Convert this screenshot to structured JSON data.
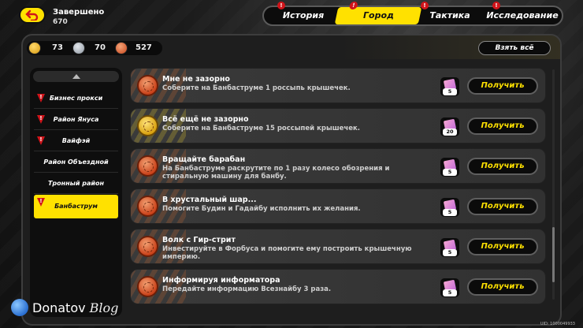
{
  "status": {
    "title": "Завершено",
    "count": "670"
  },
  "tabs": [
    {
      "label": "История",
      "alert": true,
      "active": false
    },
    {
      "label": "Город",
      "alert": true,
      "active": true
    },
    {
      "label": "Тактика",
      "alert": true,
      "active": false
    },
    {
      "label": "Исследование",
      "alert": true,
      "active": false
    }
  ],
  "currency": [
    {
      "icon": "gold-coin-icon",
      "value": "73",
      "color": "#e8b020"
    },
    {
      "icon": "silver-coin-icon",
      "value": "70",
      "color": "#9aa3ad"
    },
    {
      "icon": "bronze-coin-icon",
      "value": "527",
      "color": "#d35b2a"
    }
  ],
  "take_all_label": "Взять всё",
  "sidebar": {
    "items": [
      {
        "label": "Бизнес прокси",
        "alert": true,
        "active": false
      },
      {
        "label": "Район Януса",
        "alert": true,
        "active": false
      },
      {
        "label": "Вайфэй",
        "alert": true,
        "active": false
      },
      {
        "label": "Район Объездной",
        "alert": false,
        "active": false
      },
      {
        "label": "Тронный район",
        "alert": false,
        "active": false
      },
      {
        "label": "Банбаструм",
        "alert": true,
        "active": true
      }
    ]
  },
  "quests": [
    {
      "title": "Мне не зазорно",
      "desc": "Соберите на Банбаструме 1 россыпь крышечек.",
      "reward_count": "5",
      "button": "Получить",
      "tier": "bronze"
    },
    {
      "title": "Всё ещё не зазорно",
      "desc": "Соберите на Банбаструме 15 россыпей крышечек.",
      "reward_count": "20",
      "button": "Получить",
      "tier": "gold"
    },
    {
      "title": "Вращайте барабан",
      "desc": "На Банбаструме раскрутите по 1 разу колесо обозрения и стиральную машину для банбу.",
      "reward_count": "5",
      "button": "Получить",
      "tier": "bronze"
    },
    {
      "title": "В хрустальный шар...",
      "desc": "Помогите Будин и Гадайбу исполнить их желания.",
      "reward_count": "5",
      "button": "Получить",
      "tier": "bronze"
    },
    {
      "title": "Волк с Гир-стрит",
      "desc": "Инвестируйте в Форбуса и помогите ему построить крышечную империю.",
      "reward_count": "5",
      "button": "Получить",
      "tier": "bronze"
    },
    {
      "title": "Информируя информатора",
      "desc": "Передайте информацию Всезнайбу 3 раза.",
      "reward_count": "5",
      "button": "Получить",
      "tier": "bronze"
    }
  ],
  "watermark": {
    "name": "Donatov",
    "suffix": "Blog"
  },
  "uid": "UID: 1000049933"
}
